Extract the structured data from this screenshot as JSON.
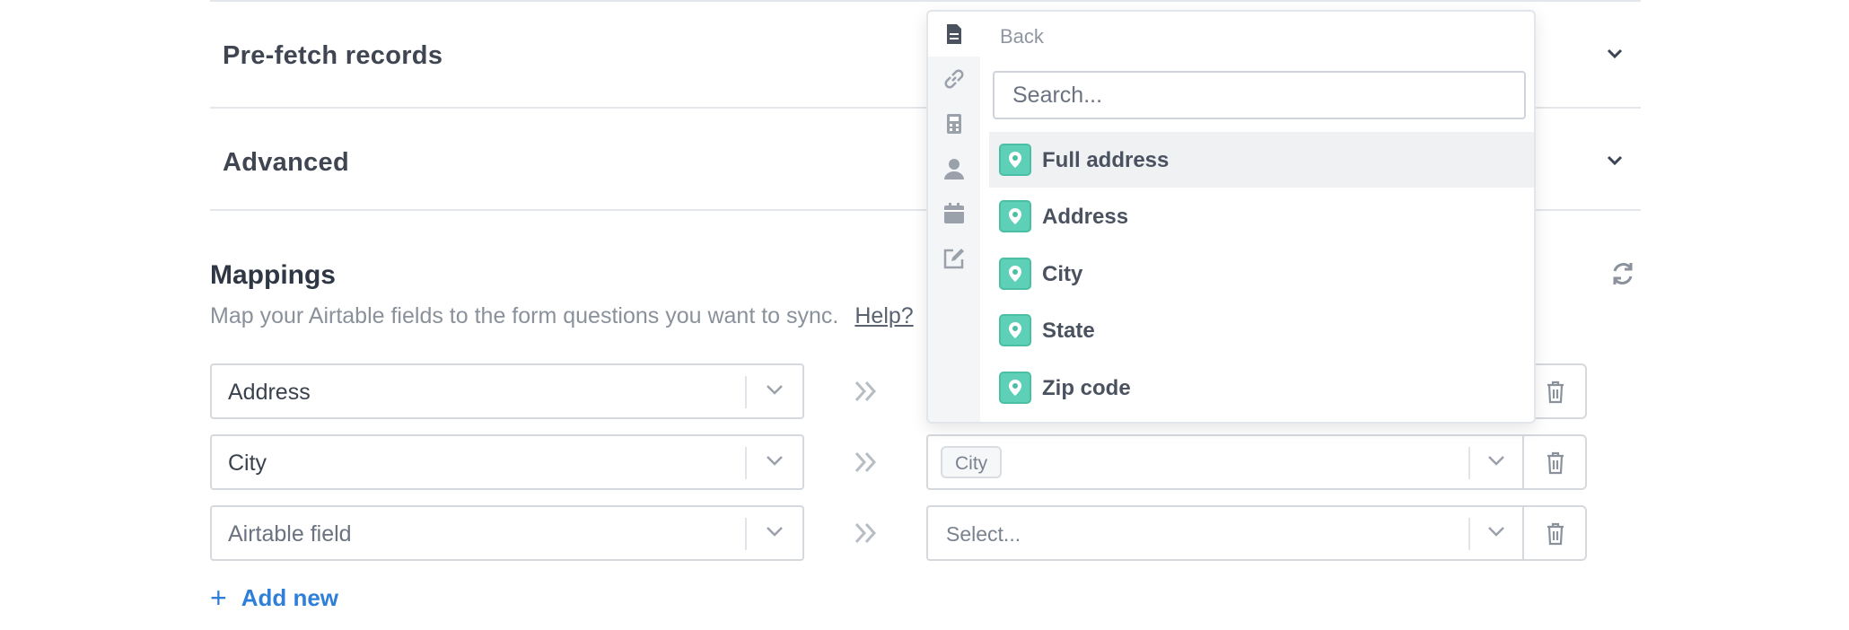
{
  "sections": {
    "prefetch_label": "Pre-fetch records",
    "advanced_label": "Advanced"
  },
  "mappings": {
    "title": "Mappings",
    "description": "Map your Airtable fields to the form questions you want to sync.",
    "help_link": "Help?",
    "rows": [
      {
        "source": "Address",
        "target": ""
      },
      {
        "source": "City",
        "target_tag": "City"
      },
      {
        "source_placeholder": "Airtable field",
        "target_placeholder": "Select..."
      }
    ],
    "add_new": "Add new"
  },
  "dropdown": {
    "back_label": "Back",
    "search_placeholder": "Search...",
    "options": [
      "Full address",
      "Address",
      "City",
      "State",
      "Zip code"
    ],
    "rail_icons": [
      "document-icon",
      "link-icon",
      "calculator-icon",
      "person-icon",
      "calendar-icon",
      "edit-icon"
    ]
  },
  "colors": {
    "accent_blue": "#2f7fd8",
    "pin_green": "#5fd0b8"
  }
}
